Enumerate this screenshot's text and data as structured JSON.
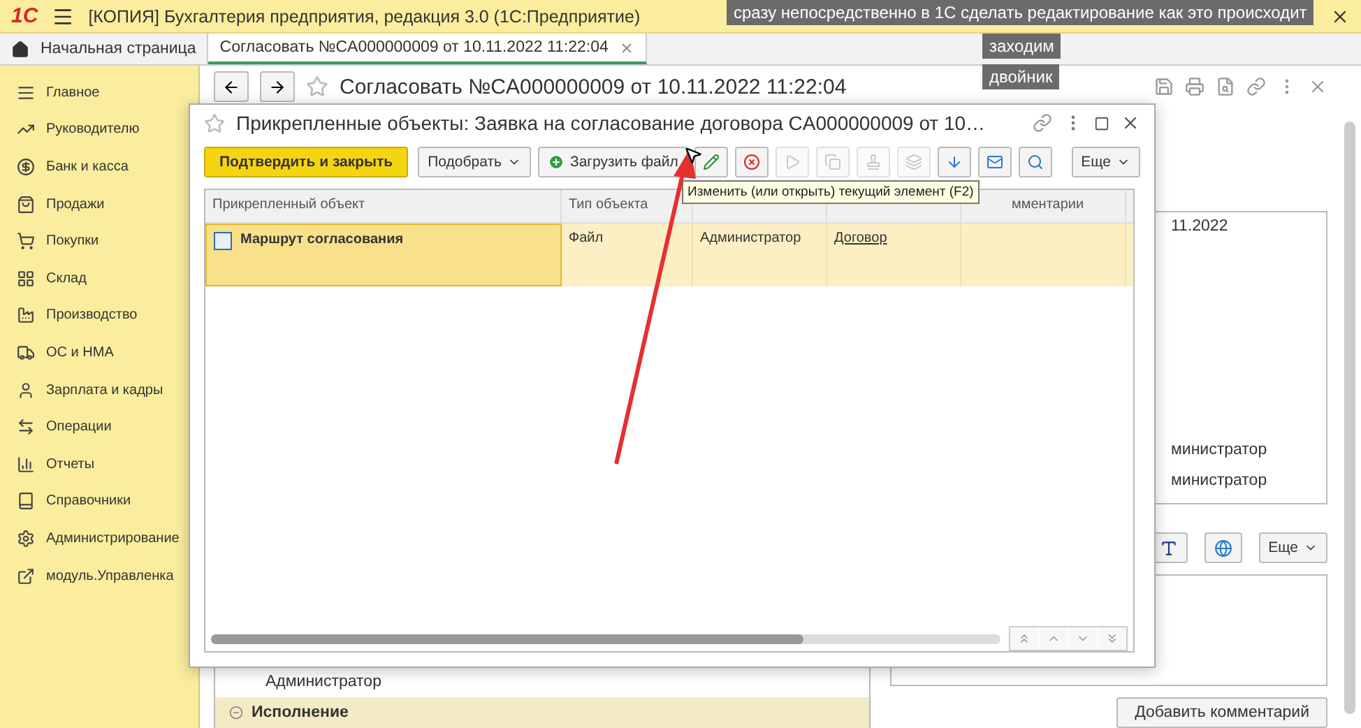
{
  "app": {
    "logo": "1С",
    "title": "[КОПИЯ] Бухгалтерия предприятия, редакция 3.0  (1С:Предприятие)"
  },
  "tabs": [
    {
      "label": "Начальная страница",
      "kind": "home",
      "selected": false
    },
    {
      "label": "Согласовать №CA000000009 от 10.11.2022 11:22:04",
      "kind": "document",
      "selected": true
    }
  ],
  "sidebar": {
    "items": [
      {
        "label": "Главное"
      },
      {
        "label": "Руководителю"
      },
      {
        "label": "Банк и касса"
      },
      {
        "label": "Продажи"
      },
      {
        "label": "Покупки"
      },
      {
        "label": "Склад"
      },
      {
        "label": "Производство"
      },
      {
        "label": "ОС и НМА"
      },
      {
        "label": "Зарплата и кадры"
      },
      {
        "label": "Операции"
      },
      {
        "label": "Отчеты"
      },
      {
        "label": "Справочники"
      },
      {
        "label": "Администрирование"
      },
      {
        "label": "модуль.Управленка"
      }
    ]
  },
  "form": {
    "title": "Согласовать №CA000000009 от 10.11.2022 11:22:04",
    "tree_rows": [
      {
        "label": "Администратор",
        "kind": "item"
      },
      {
        "label": "Исполнение",
        "kind": "group",
        "expanded": true
      }
    ],
    "history": {
      "date": "11.2022",
      "lines": [
        "министратор",
        "министратор"
      ]
    },
    "more_button": "Еще",
    "add_comment_button": "Добавить комментарий"
  },
  "dialog": {
    "title": "Прикрепленные объекты: Заявка на согласование договора CA000000009 от 10…",
    "buttons": [
      {
        "kind": "primary",
        "label": "Подтвердить и закрыть"
      },
      {
        "kind": "menu",
        "label": "Подобрать"
      },
      {
        "kind": "upload",
        "label": "Загрузить файл"
      }
    ],
    "icon_buttons": [
      {
        "disabled": false
      },
      {
        "disabled": false
      },
      {
        "disabled": true
      },
      {
        "disabled": true
      },
      {
        "disabled": true
      },
      {
        "disabled": true
      },
      {
        "disabled": false
      },
      {
        "disabled": false
      },
      {
        "disabled": false
      }
    ],
    "more_button": "Еще",
    "tooltip": "Изменить (или открыть) текущий элемент (F2)",
    "columns": [
      {
        "label": "Прикрепленный объект",
        "kind": "file"
      },
      {
        "label": "Тип объекта",
        "kind": "text"
      },
      {
        "kind": "text"
      },
      {
        "kind": "link"
      },
      {
        "label": "мментарии",
        "kind": "text"
      }
    ],
    "rows": [
      {
        "selected": true,
        "cells": [
          "Маршрут согласования",
          "Файл",
          "Администратор",
          "Договор"
        ]
      }
    ]
  },
  "captions": [
    "сразу непосредственно в 1С сделать редактирование как это происходит",
    "заходим",
    "двойник"
  ]
}
